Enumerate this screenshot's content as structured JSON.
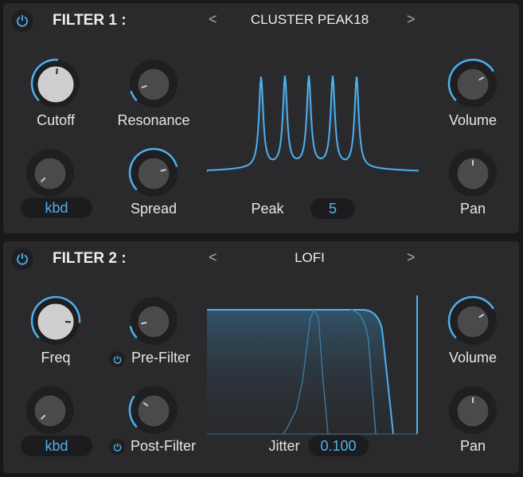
{
  "colors": {
    "accent": "#4db1f0",
    "panel": "#2a2a2c"
  },
  "filter1": {
    "title": "FILTER 1 :",
    "preset": "CLUSTER PEAK18",
    "prev": "<",
    "next": ">",
    "knobs": {
      "cutoff": {
        "label": "Cutoff",
        "value": 0.52
      },
      "resonance": {
        "label": "Resonance",
        "value": 0.1
      },
      "kbd": {
        "label": "kbd",
        "value": 0.0
      },
      "spread": {
        "label": "Spread",
        "value": 0.78
      },
      "volume": {
        "label": "Volume",
        "value": 0.72
      },
      "pan": {
        "label": "Pan",
        "value": 0.5
      }
    },
    "param": {
      "label": "Peak",
      "value": "5"
    }
  },
  "filter2": {
    "title": "FILTER 2 :",
    "preset": "LOFI",
    "prev": "<",
    "next": ">",
    "knobs": {
      "freq": {
        "label": "Freq",
        "value": 0.85
      },
      "prefilter": {
        "label": "Pre-Filter",
        "value": 0.12
      },
      "kbd": {
        "label": "kbd",
        "value": 0.0
      },
      "postfilter": {
        "label": "Post-Filter",
        "value": 0.3
      },
      "volume": {
        "label": "Volume",
        "value": 0.72
      },
      "pan": {
        "label": "Pan",
        "value": 0.5
      }
    },
    "param": {
      "label": "Jitter",
      "value": "0.100"
    }
  }
}
